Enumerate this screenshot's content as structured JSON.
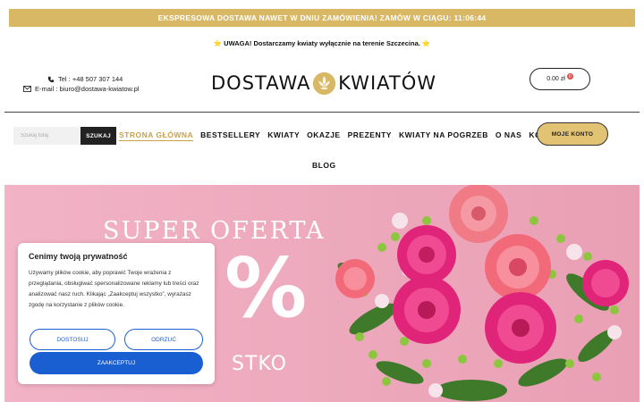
{
  "promo": {
    "text": "EKSPRESOWA DOSTAWA NAWET W DNIU ZAMÓWIENIA! ZAMÓW W CIĄGU: 11:06:44"
  },
  "notice": {
    "text": "⭐ UWAGA! Dostarczamy kwiaty wyłącznie na terenie Szczecina. ⭐"
  },
  "contact": {
    "phone": "Tel : +48 507 307 144",
    "email": "E-mail : biuro@dostawa-kwiatow.pl"
  },
  "logo": {
    "left": "DOSTAWA",
    "right": "KWIATÓW"
  },
  "cart": {
    "amount": "0.00 zł",
    "count": "0"
  },
  "search": {
    "placeholder": "Szukaj tutaj",
    "button": "SZUKAJ"
  },
  "nav": {
    "items": [
      {
        "label": "STRONA GŁÓWNA"
      },
      {
        "label": "BESTSELLERY"
      },
      {
        "label": "KWIATY"
      },
      {
        "label": "OKAZJE"
      },
      {
        "label": "PREZENTY"
      },
      {
        "label": "KWIATY NA POGRZEB"
      },
      {
        "label": "O NAS"
      },
      {
        "label": "KONTAKT"
      },
      {
        "label": "BLOG"
      }
    ]
  },
  "account": {
    "label": "MOJE KONTO"
  },
  "hero": {
    "title": "SUPER OFERTA",
    "percent": "%",
    "sub": "STKO"
  },
  "cookie": {
    "title": "Cenimy twoją prywatność",
    "text": "Używamy plików cookie, aby poprawić Twoje wrażenia z przeglądania, obsługiwać spersonalizowane reklamy lub treści oraz analizować nasz ruch. Klikając „Zaakceptuj wszystko”, wyrażasz zgodę na korzystanie z plików cookie.",
    "customize": "DOSTOSUJ",
    "reject": "ODRZUĆ",
    "accept": "ZAAKCEPTUJ"
  },
  "colors": {
    "gold": "#d8b865",
    "hero_pink": "#eda8bc",
    "accept_blue": "#1a5fd1"
  },
  "icons": {
    "phone": "phone-icon",
    "email": "envelope-icon",
    "logo": "flower-emblem-icon"
  }
}
